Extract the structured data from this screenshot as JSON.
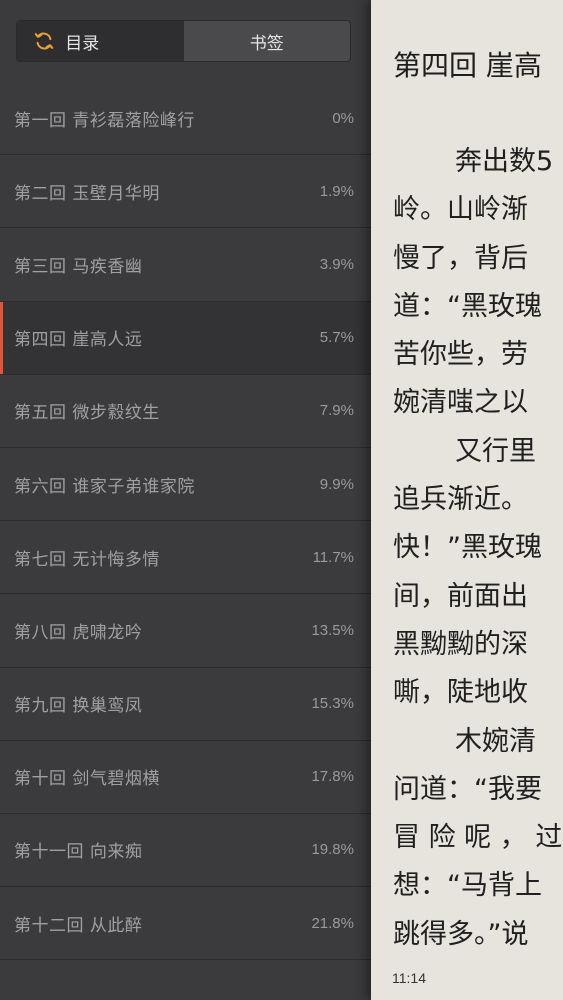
{
  "toc": {
    "tabs": [
      {
        "label": "目录",
        "active": true
      },
      {
        "label": "书签",
        "active": false
      }
    ],
    "items": [
      {
        "title": "第一回 青衫磊落险峰行",
        "percent": "0%"
      },
      {
        "title": "第二回 玉壁月华明",
        "percent": "1.9%"
      },
      {
        "title": "第三回 马疾香幽",
        "percent": "3.9%"
      },
      {
        "title": "第四回 崖高人远",
        "percent": "5.7%",
        "current": true
      },
      {
        "title": "第五回 微步縠纹生",
        "percent": "7.9%"
      },
      {
        "title": "第六回 谁家子弟谁家院",
        "percent": "9.9%"
      },
      {
        "title": "第七回 无计悔多情",
        "percent": "11.7%"
      },
      {
        "title": "第八回 虎啸龙吟",
        "percent": "13.5%"
      },
      {
        "title": "第九回 换巢鸾凤",
        "percent": "15.3%"
      },
      {
        "title": "第十回 剑气碧烟横",
        "percent": "17.8%"
      },
      {
        "title": "第十一回 向来痴",
        "percent": "19.8%"
      },
      {
        "title": "第十二回 从此醉",
        "percent": "21.8%"
      }
    ],
    "accent_color": "#e0553c",
    "refresh_icon_color": "#f0a030"
  },
  "reader": {
    "chapter_heading": "第四回 崖高",
    "lines": [
      {
        "text": "奔出数5",
        "indent": true
      },
      {
        "text": "岭。山岭渐",
        "indent": false
      },
      {
        "text": "慢了，背后",
        "indent": false
      },
      {
        "text": "道：“黑玫瑰",
        "indent": false
      },
      {
        "text": "苦你些，劳",
        "indent": false
      },
      {
        "text": "婉清嗤之以",
        "indent": false
      },
      {
        "text": "又行里",
        "indent": true
      },
      {
        "text": "追兵渐近。",
        "indent": false
      },
      {
        "text": "快！”黑玫瑰",
        "indent": false
      },
      {
        "text": "间，前面出",
        "indent": false
      },
      {
        "text": "黑黝黝的深",
        "indent": false
      },
      {
        "text": "嘶，陡地收",
        "indent": false
      },
      {
        "text": "木婉清",
        "indent": true
      },
      {
        "text": "问道：“我要",
        "indent": false
      },
      {
        "text": "冒 险 呢 ， 过",
        "indent": false
      },
      {
        "text": "想：“马背上",
        "indent": false
      },
      {
        "text": "跳得多。”说",
        "indent": false
      }
    ],
    "clock": "11:14"
  }
}
